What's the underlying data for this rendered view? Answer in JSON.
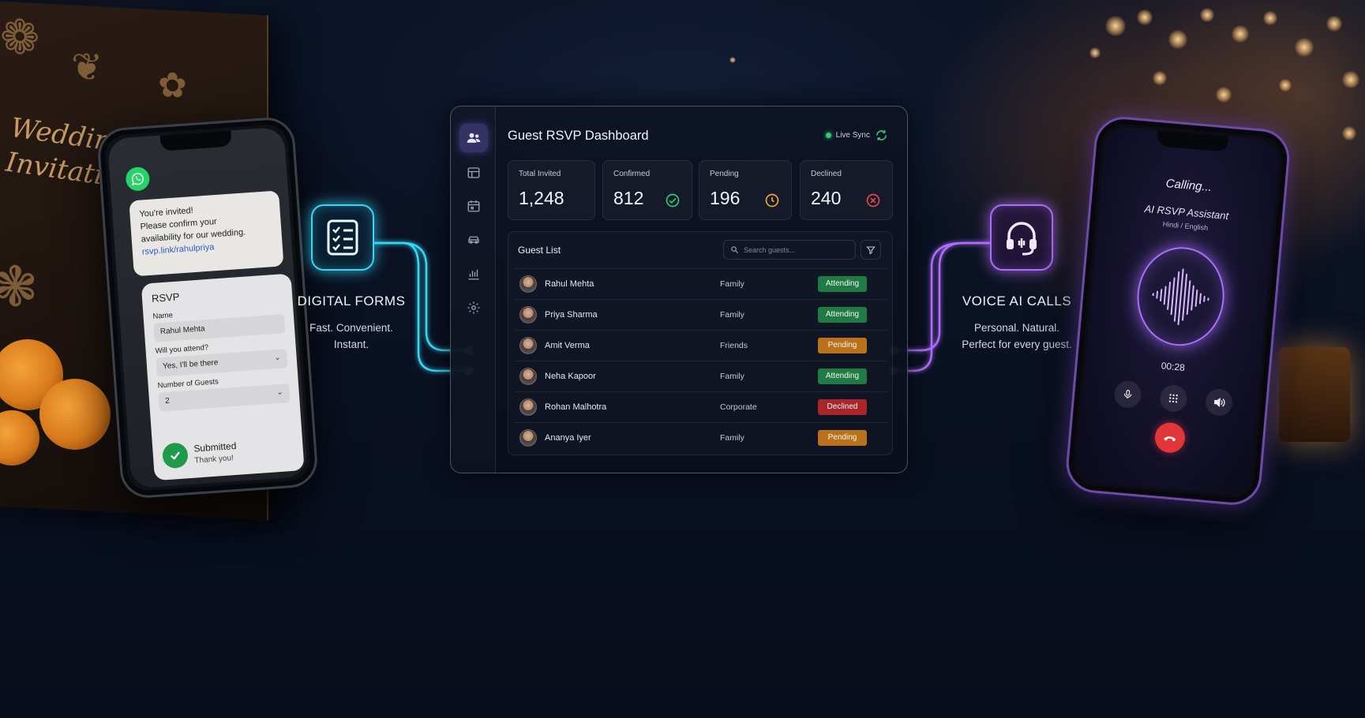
{
  "invitation": {
    "title": "Wedding Invitation"
  },
  "left_phone": {
    "message_lines": [
      "You're invited!",
      "Please confirm your",
      "availability for our wedding."
    ],
    "message_link": "rsvp.link/rahulpriya",
    "form": {
      "title": "RSVP",
      "name_label": "Name",
      "name_value": "Rahul Mehta",
      "attend_label": "Will you attend?",
      "attend_value": "Yes, I'll be there",
      "guests_label": "Number of Guests",
      "guests_value": "2"
    },
    "submitted_title": "Submitted",
    "submitted_sub": "Thank you!"
  },
  "features": {
    "left": {
      "title": "DIGITAL FORMS",
      "line1": "Fast. Convenient.",
      "line2": "Instant.",
      "icon": "checklist-icon",
      "color": "#37d7f5"
    },
    "right": {
      "title": "VOICE AI CALLS",
      "line1": "Personal. Natural.",
      "line2": "Perfect for every guest.",
      "icon": "headset-icon",
      "color": "#b06cff"
    }
  },
  "dashboard": {
    "title": "Guest RSVP Dashboard",
    "live_label": "Live Sync",
    "sidebar": [
      "users-icon",
      "seating-icon",
      "calendar-icon",
      "car-icon",
      "bar-chart-icon",
      "settings-icon"
    ],
    "stats": [
      {
        "label": "Total Invited",
        "value": "1,248",
        "icon": ""
      },
      {
        "label": "Confirmed",
        "value": "812",
        "icon": "check-circle-icon",
        "color": "#2ecc71"
      },
      {
        "label": "Pending",
        "value": "196",
        "icon": "clock-icon",
        "color": "#f0a53a"
      },
      {
        "label": "Declined",
        "value": "240",
        "icon": "x-circle-icon",
        "color": "#e24b4b"
      }
    ],
    "guest_list": {
      "title": "Guest List",
      "search_placeholder": "Search guests...",
      "rows": [
        {
          "name": "Rahul Mehta",
          "group": "Family",
          "status": "Attending"
        },
        {
          "name": "Priya Sharma",
          "group": "Family",
          "status": "Attending"
        },
        {
          "name": "Amit Verma",
          "group": "Friends",
          "status": "Pending"
        },
        {
          "name": "Neha Kapoor",
          "group": "Family",
          "status": "Attending"
        },
        {
          "name": "Rohan Malhotra",
          "group": "Corporate",
          "status": "Declined"
        },
        {
          "name": "Ananya Iyer",
          "group": "Family",
          "status": "Pending"
        }
      ]
    },
    "status_colors": {
      "Attending": "#1f7a44",
      "Pending": "#b9711a",
      "Declined": "#a8262a"
    }
  },
  "right_phone": {
    "calling": "Calling...",
    "assistant": "AI RSVP Assistant",
    "language": "Hindi / English",
    "timer": "00:28"
  }
}
